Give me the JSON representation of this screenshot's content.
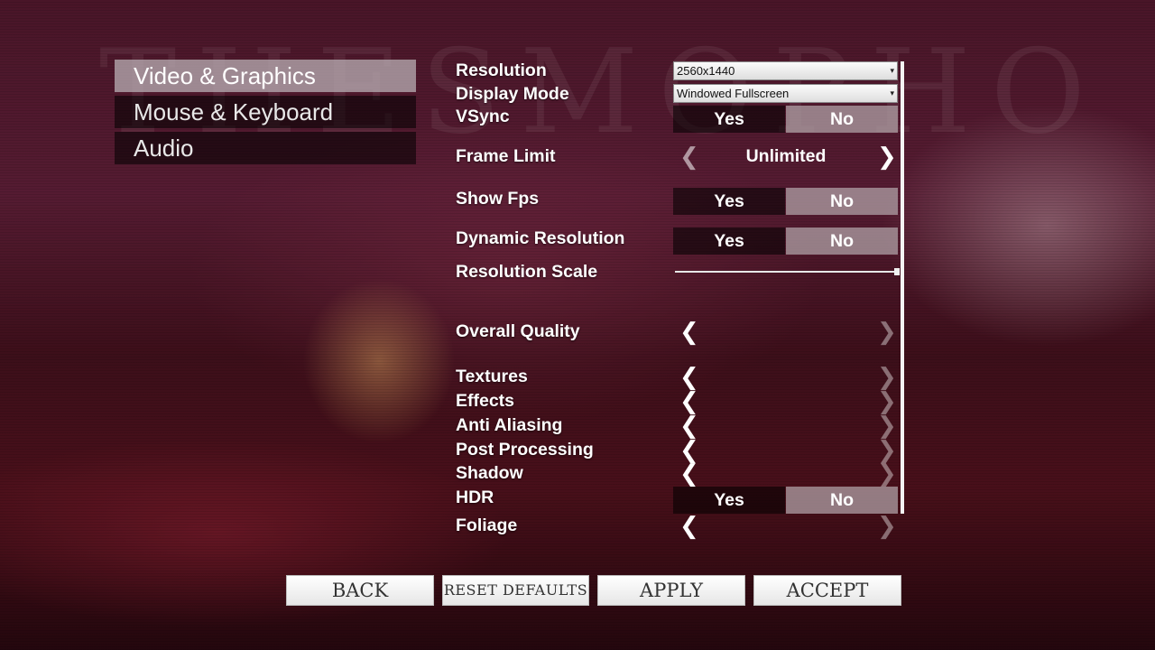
{
  "colors": {
    "accent_panel": "#b4a9ae",
    "dark_panel": "#1a0a0e",
    "text": "#ffffff"
  },
  "menu": {
    "items": [
      {
        "label": "Video & Graphics",
        "active": true
      },
      {
        "label": "Mouse & Keyboard",
        "active": false
      },
      {
        "label": "Audio",
        "active": false
      }
    ]
  },
  "settings": {
    "resolution": {
      "label": "Resolution",
      "value": "2560x1440"
    },
    "display_mode": {
      "label": "Display Mode",
      "value": "Windowed Fullscreen"
    },
    "vsync": {
      "label": "VSync",
      "yes": "Yes",
      "no": "No",
      "selected": "No"
    },
    "frame_limit": {
      "label": "Frame Limit",
      "value": "Unlimited"
    },
    "show_fps": {
      "label": "Show Fps",
      "yes": "Yes",
      "no": "No",
      "selected": "No"
    },
    "dynamic_resolution": {
      "label": "Dynamic Resolution",
      "yes": "Yes",
      "no": "No",
      "selected": "No"
    },
    "resolution_scale": {
      "label": "Resolution Scale",
      "level": 1.0
    },
    "overall_quality": {
      "label": "Overall Quality",
      "value": ""
    },
    "textures": {
      "label": "Textures",
      "value": ""
    },
    "effects": {
      "label": "Effects",
      "value": ""
    },
    "anti_aliasing": {
      "label": "Anti Aliasing",
      "value": ""
    },
    "post_processing": {
      "label": "Post Processing",
      "value": ""
    },
    "shadow": {
      "label": "Shadow",
      "value": ""
    },
    "hdr": {
      "label": "HDR",
      "yes": "Yes",
      "no": "No",
      "selected": "No"
    },
    "foliage": {
      "label": "Foliage",
      "value": ""
    }
  },
  "buttons": {
    "back": "BACK",
    "reset_defaults": "RESET DEFAULTS",
    "apply": "APPLY",
    "accept": "ACCEPT"
  },
  "icons": {
    "left_arrow": "chevron-left-icon",
    "right_arrow": "chevron-right-icon",
    "dropdown": "caret-down-icon"
  }
}
